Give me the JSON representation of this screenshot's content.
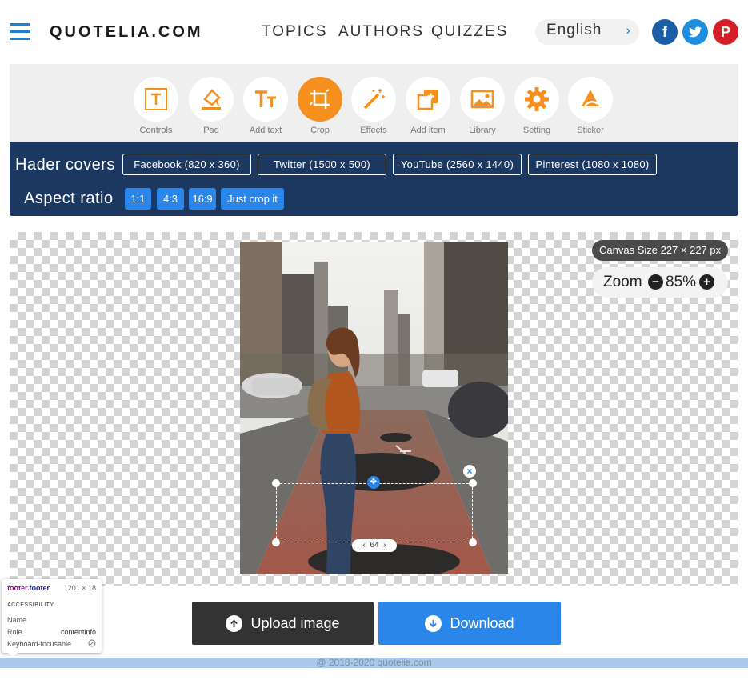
{
  "header": {
    "logo": "QUOTELIA.COM",
    "nav": [
      "TOPICS",
      "AUTHORS",
      "QUIZZES"
    ],
    "language": "English",
    "social": [
      "facebook-icon",
      "twitter-icon",
      "pinterest-icon"
    ]
  },
  "toolbar": {
    "tools": [
      {
        "label": "Controls",
        "icon": "text-frame-icon"
      },
      {
        "label": "Pad",
        "icon": "paint-bucket-icon"
      },
      {
        "label": "Add text",
        "icon": "text-tool-icon"
      },
      {
        "label": "Crop",
        "icon": "crop-icon",
        "active": true
      },
      {
        "label": "Effects",
        "icon": "magic-wand-icon"
      },
      {
        "label": "Add item",
        "icon": "add-layer-icon"
      },
      {
        "label": "Library",
        "icon": "image-library-icon"
      },
      {
        "label": "Setting",
        "icon": "gear-icon"
      },
      {
        "label": "Sticker",
        "icon": "sticker-icon"
      }
    ]
  },
  "crop": {
    "covers_title": "Hader covers",
    "covers": [
      "Facebook (820 x 360)",
      "Twitter (1500 x 500)",
      "YouTube (2560 x 1440)",
      "Pinterest (1080 x 1080)"
    ],
    "ratio_title": "Aspect ratio",
    "ratios": [
      "1:1",
      "4:3",
      "16:9",
      "Just crop it"
    ]
  },
  "canvas": {
    "size_text": "Canvas Size 227 × 227 px",
    "zoom_label": "Zoom",
    "zoom_value": "85%",
    "selection_value": "64"
  },
  "actions": {
    "upload": "Upload image",
    "download": "Download"
  },
  "footer": {
    "text": "@ 2018-2020 quotelia.com"
  },
  "devtools": {
    "selector_tag": "footer",
    "selector_class": ".footer",
    "dimensions": "1201 × 18",
    "section": "ACCESSIBILITY",
    "rows": [
      {
        "key": "Name",
        "value": ""
      },
      {
        "key": "Role",
        "value": "contentinfo"
      },
      {
        "key": "Keyboard-focusable",
        "value": ""
      }
    ]
  },
  "colors": {
    "accent_orange": "#f5901e",
    "brand_blue": "#2a86e8",
    "navy": "#1c3860",
    "dark_button": "#333333"
  }
}
